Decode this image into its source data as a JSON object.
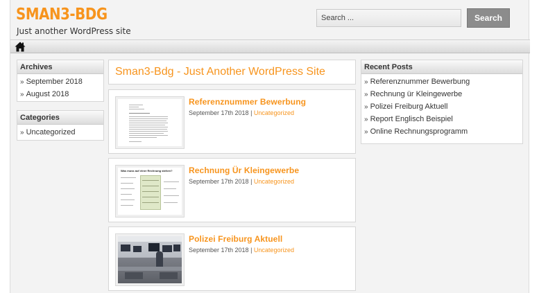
{
  "header": {
    "site_title": "SMAN3-BDG",
    "site_description": "Just another WordPress site"
  },
  "search": {
    "placeholder": "Search ...",
    "button_label": "Search"
  },
  "nav": {
    "home_icon": "home-icon"
  },
  "left_sidebar": {
    "archives": {
      "heading": "Archives",
      "items": [
        "September 2018",
        "August 2018"
      ]
    },
    "categories": {
      "heading": "Categories",
      "items": [
        "Uncategorized"
      ]
    }
  },
  "main": {
    "heading": "Sman3-Bdg - Just Another WordPress Site",
    "posts": [
      {
        "title": "Referenznummer Bewerbung",
        "date": "September 17th 2018",
        "separator": " | ",
        "category": "Uncategorized"
      },
      {
        "title": "Rechnung Ür Kleingewerbe",
        "date": "September 17th 2018",
        "separator": " | ",
        "category": "Uncategorized"
      },
      {
        "title": "Polizei Freiburg Aktuell",
        "date": "September 17th 2018",
        "separator": " | ",
        "category": "Uncategorized"
      }
    ],
    "thumb2_heading": "Was muss auf einer Rechnung stehen?"
  },
  "right_sidebar": {
    "recent_posts": {
      "heading": "Recent Posts",
      "items": [
        "Referenznummer Bewerbung",
        "Rechnung ür Kleingewerbe",
        "Polizei Freiburg Aktuell",
        "Report Englisch Beispiel",
        "Online Rechnungsprogramm"
      ]
    }
  },
  "colors": {
    "accent": "#f7941d",
    "page_bg": "#f3f3f3",
    "search_button": "#8c8c8c"
  }
}
